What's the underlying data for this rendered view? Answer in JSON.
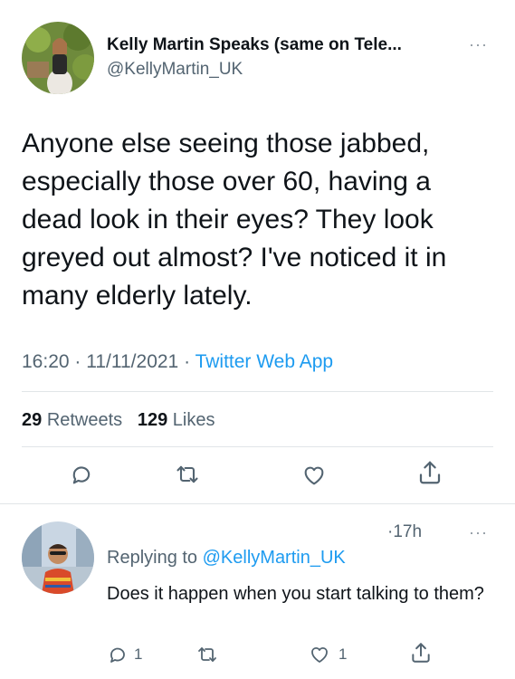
{
  "tweet": {
    "author_name": "Kelly Martin Speaks (same on Tele...",
    "author_handle": "@KellyMartin_UK",
    "more_glyph": "···",
    "text": "Anyone else seeing those jabbed, especially those over 60, having a dead look in their eyes? They look greyed out almost? I've noticed it in many elderly lately.",
    "time": "16:20",
    "date": "11/11/2021",
    "source": "Twitter Web App",
    "separator": "·",
    "retweets_count": "29",
    "retweets_label": "Retweets",
    "likes_count": "129",
    "likes_label": "Likes"
  },
  "reply": {
    "age": "17h",
    "age_separator": "·",
    "more_glyph": "···",
    "replying_to_label": "Replying to",
    "replying_to_handle": "@KellyMartin_UK",
    "text": "Does it happen when you start talking to them?",
    "reply_count": "1",
    "like_count": "1"
  },
  "colors": {
    "accent": "#1d9bf0",
    "secondary_text": "#536471",
    "primary_text": "#0f1419",
    "divider": "#e1e5e8"
  },
  "icons": [
    "reply-icon",
    "retweet-icon",
    "like-icon",
    "share-icon",
    "more-icon"
  ]
}
